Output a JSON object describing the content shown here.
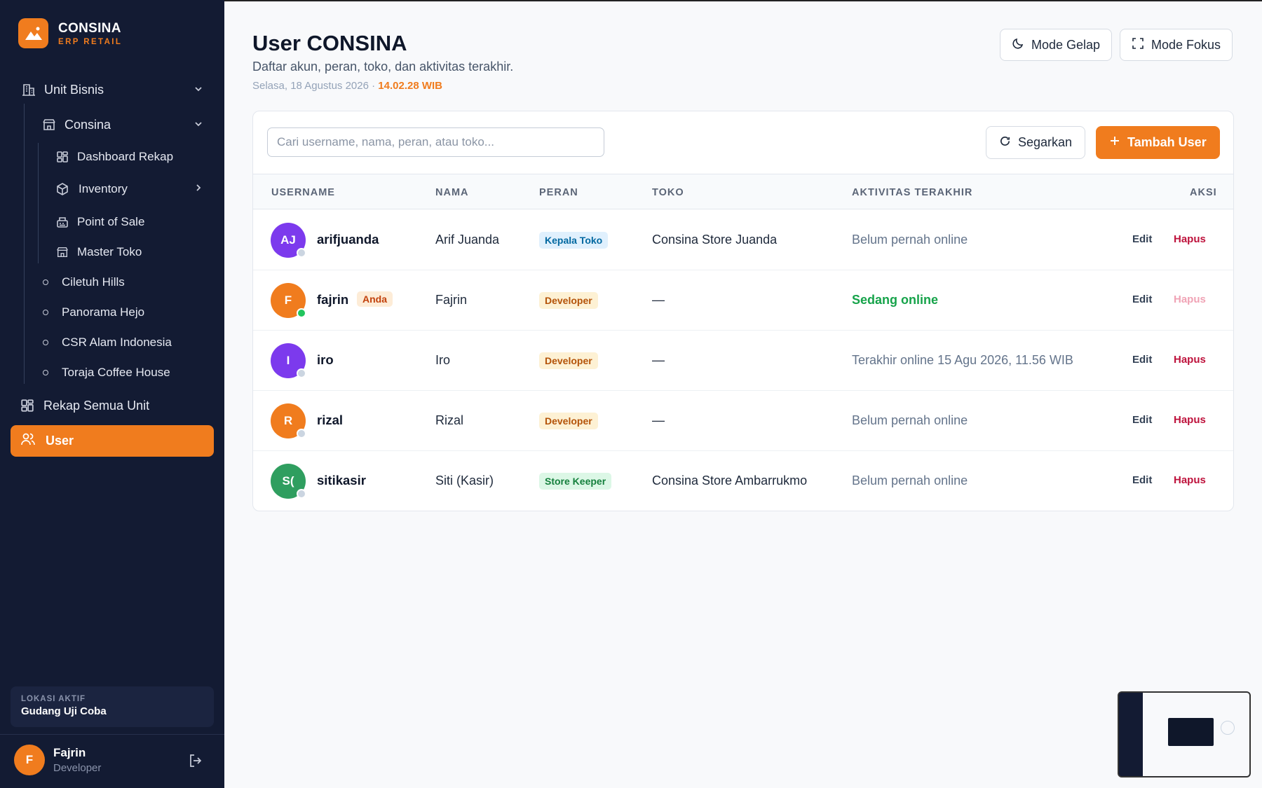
{
  "brand": {
    "name": "CONSINA",
    "tagline": "ERP RETAIL"
  },
  "sidebar": {
    "unit_bisnis": "Unit Bisnis",
    "consina": "Consina",
    "consina_items": [
      "Dashboard Rekap",
      "Inventory",
      "Point of Sale",
      "Master Toko"
    ],
    "units": [
      "Ciletuh Hills",
      "Panorama Hejo",
      "CSR Alam Indonesia",
      "Toraja Coffee House"
    ],
    "rekap_semua": "Rekap Semua Unit",
    "user": "User",
    "location_label": "LOKASI AKTIF",
    "location_value": "Gudang Uji Coba",
    "profile_initial": "F",
    "profile_name": "Fajrin",
    "profile_role": "Developer"
  },
  "header": {
    "title": "User CONSINA",
    "subtitle": "Daftar akun, peran, toko, dan aktivitas terakhir.",
    "date": "Selasa, 18 Agustus 2026 · ",
    "time": "14.02.28 WIB",
    "dark_mode": "Mode Gelap",
    "focus_mode": "Mode Fokus"
  },
  "toolbar": {
    "search_placeholder": "Cari username, nama, peran, atau toko...",
    "refresh": "Segarkan",
    "add_user": "Tambah User"
  },
  "table": {
    "columns": [
      "USERNAME",
      "NAMA",
      "PERAN",
      "TOKO",
      "AKTIVITAS TERAKHIR",
      "AKSI"
    ],
    "rows": [
      {
        "initials": "AJ",
        "avatar_color": "#7c3aed",
        "status": "offline",
        "username": "arifjuanda",
        "you": "",
        "name": "Arif Juanda",
        "role": "Kepala Toko",
        "role_style": "blue",
        "store": "Consina Store Juanda",
        "activity": "Belum pernah online",
        "activity_style": "muted",
        "edit": "Edit",
        "delete": "Hapus",
        "delete_disabled": false
      },
      {
        "initials": "F",
        "avatar_color": "#f07c1e",
        "status": "online",
        "username": "fajrin",
        "you": "Anda",
        "name": "Fajrin",
        "role": "Developer",
        "role_style": "amber",
        "store": "—",
        "activity": "Sedang online",
        "activity_style": "online",
        "edit": "Edit",
        "delete": "Hapus",
        "delete_disabled": true
      },
      {
        "initials": "I",
        "avatar_color": "#7c3aed",
        "status": "offline",
        "username": "iro",
        "you": "",
        "name": "Iro",
        "role": "Developer",
        "role_style": "amber",
        "store": "—",
        "activity": "Terakhir online 15 Agu 2026, 11.56 WIB",
        "activity_style": "muted",
        "edit": "Edit",
        "delete": "Hapus",
        "delete_disabled": false
      },
      {
        "initials": "R",
        "avatar_color": "#f07c1e",
        "status": "offline",
        "username": "rizal",
        "you": "",
        "name": "Rizal",
        "role": "Developer",
        "role_style": "amber",
        "store": "—",
        "activity": "Belum pernah online",
        "activity_style": "muted",
        "edit": "Edit",
        "delete": "Hapus",
        "delete_disabled": false
      },
      {
        "initials": "S(",
        "avatar_color": "#2f9e5f",
        "status": "offline",
        "username": "sitikasir",
        "you": "",
        "name": "Siti (Kasir)",
        "role": "Store Keeper",
        "role_style": "green",
        "store": "Consina Store Ambarrukmo",
        "activity": "Belum pernah online",
        "activity_style": "muted",
        "edit": "Edit",
        "delete": "Hapus",
        "delete_disabled": false
      }
    ]
  },
  "colors": {
    "accent": "#f07c1e",
    "sidebar_bg": "#131b33",
    "online": "#16a34a",
    "danger": "#be123c"
  }
}
